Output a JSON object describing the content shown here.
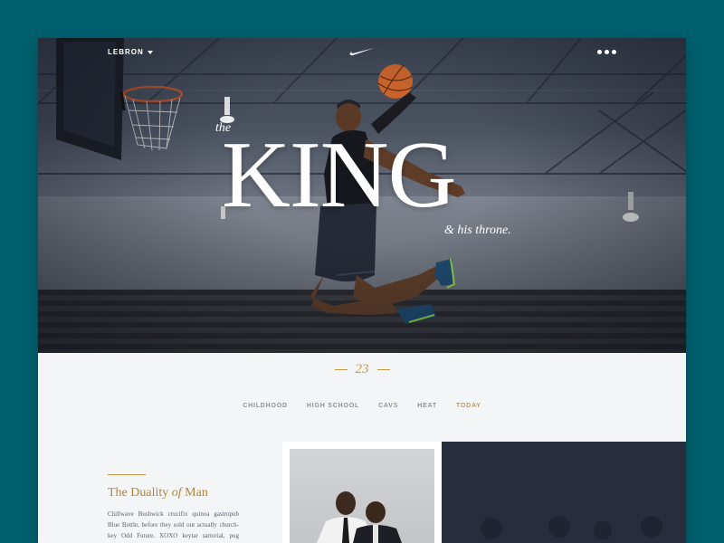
{
  "header": {
    "menu_label": "LEBRON",
    "logo": "nike-swoosh-logo",
    "more_icon": "more-dots-icon"
  },
  "hero": {
    "prefix": "the",
    "title": "KING",
    "suffix": "& his throne."
  },
  "jersey_number": "23",
  "tabs": [
    {
      "label": "CHILDHOOD",
      "active": false
    },
    {
      "label": "HIGH SCHOOL",
      "active": false
    },
    {
      "label": "CAVS",
      "active": false
    },
    {
      "label": "HEAT",
      "active": false
    },
    {
      "label": "TODAY",
      "active": true
    }
  ],
  "article": {
    "title_pre": "The Duality ",
    "title_em": "of",
    "title_post": " Man",
    "body": "Chillwave Bushwick crucifix quinoa gastropub Blue Bottle, before they sold out actually church-key Odd Future. XOXO keytar sartorial, pug disrupt"
  },
  "colors": {
    "background": "#00606e",
    "accent": "#c59a4a",
    "dark_panel": "#272d3d",
    "tab_inactive": "#8c9099"
  }
}
